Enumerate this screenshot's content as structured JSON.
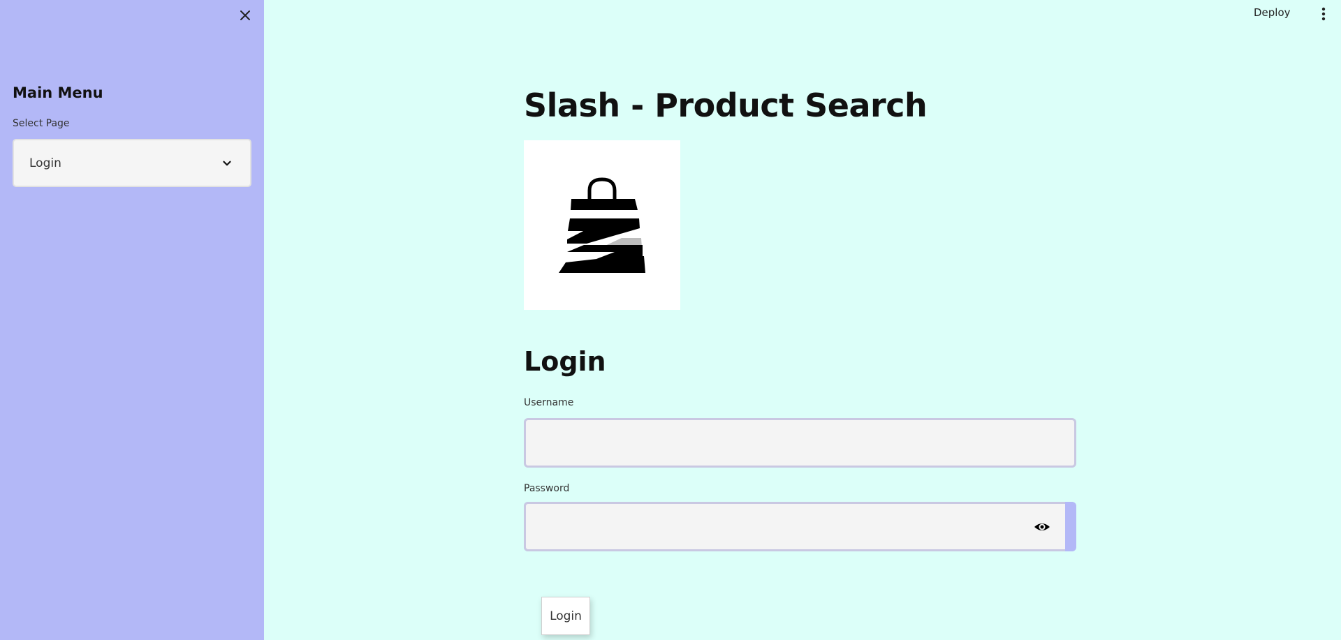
{
  "sidebar": {
    "menu_title": "Main Menu",
    "select_label": "Select Page",
    "select_value": "Login",
    "close_icon": "close-icon",
    "chevron_icon": "chevron-down-icon"
  },
  "header": {
    "deploy_label": "Deploy",
    "menu_icon": "kebab-menu-icon"
  },
  "main": {
    "title": "Slash - Product Search",
    "logo_icon": "shopping-bag-logo",
    "section_title": "Login",
    "username_label": "Username",
    "username_value": "",
    "password_label": "Password",
    "password_value": "",
    "eye_icon": "eye-icon",
    "login_button_label": "Login"
  },
  "colors": {
    "sidebar_bg": "#b3b8f7",
    "main_bg": "#dcfff9",
    "input_bg": "#f4f4f4",
    "accent": "#b3b8f7"
  }
}
